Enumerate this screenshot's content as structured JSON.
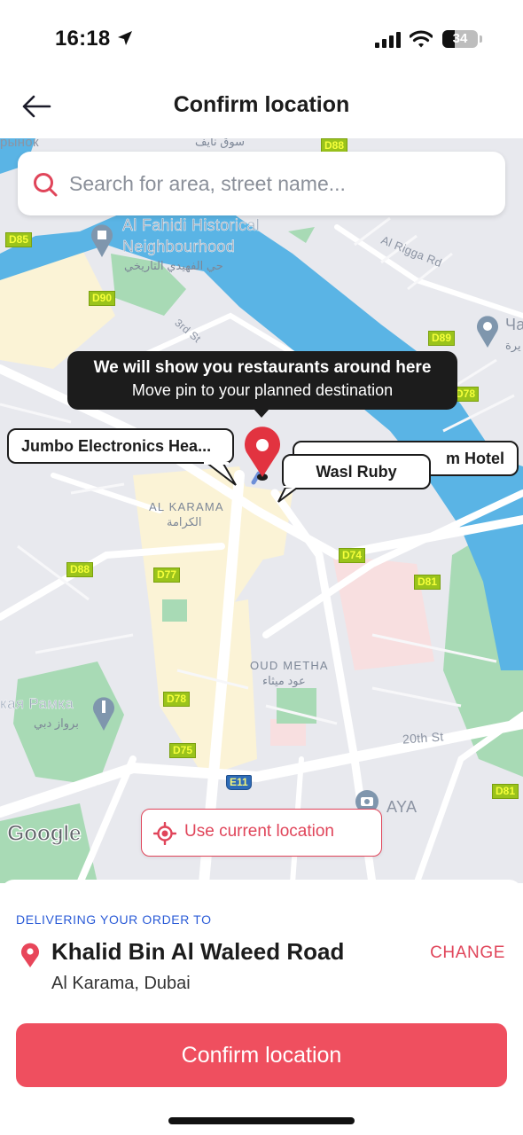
{
  "status_bar": {
    "time": "16:18",
    "battery_percent": 34,
    "battery_label": "34",
    "icons": [
      "location-arrow-icon",
      "cellular-signal-icon",
      "wifi-icon",
      "battery-icon"
    ]
  },
  "header": {
    "back_icon": "arrow-left-icon",
    "title": "Confirm location"
  },
  "search": {
    "placeholder": "Search for area, street name...",
    "value": "",
    "icon": "search-icon"
  },
  "map": {
    "tooltip": {
      "line1": "We will show you restaurants around here",
      "line2": "Move pin to your planned destination"
    },
    "nearby_places": [
      {
        "label": "Jumbo Electronics Hea..."
      },
      {
        "label": "m Hotel"
      },
      {
        "label": "Wasl Ruby"
      }
    ],
    "labels": {
      "top_left_ru": "рынок",
      "top_ar": "سوق نايف",
      "fahidi_en_1": "Al Fahidi Historical",
      "fahidi_en_2": "Neighbourhood",
      "fahidi_ar": "حي الفهيدي التاريخي",
      "al_rigga": "Al Rigga Rd",
      "third_st": "3rd St",
      "karama_en": "AL KARAMA",
      "karama_ar": "الكرامة",
      "oud_metha_en": "OUD METHA",
      "oud_metha_ar": "عود ميثاء",
      "frame_ru": "кая Рамка",
      "frame_ar": "برواز دبي",
      "twentieth_st": "20th St",
      "aya": "AYA",
      "right_edge_1": "Ча",
      "right_edge_2": "يرة"
    },
    "road_shields": {
      "d88_top": "D88",
      "d85": "D85",
      "d90": "D90",
      "d89": "D89",
      "d78_r": "D78",
      "d74": "D74",
      "d81_a": "D81",
      "d88_b": "D88",
      "d77": "D77",
      "d78": "D78",
      "d75": "D75",
      "e11": "E11",
      "d81_b": "D81"
    },
    "attribution": "Google",
    "use_current_location": "Use current location"
  },
  "delivery": {
    "label": "DELIVERING YOUR ORDER TO",
    "address_title": "Khalid Bin Al Waleed Road",
    "address_subtitle": "Al Karama, Dubai",
    "change_label": "CHANGE"
  },
  "confirm_button": "Confirm location",
  "colors": {
    "accent": "#ef4f5f",
    "accent_text": "#e0455a",
    "link_blue": "#2a5bd7",
    "water": "#5ab4e5",
    "park": "#a8dab5",
    "map_bg": "#e8e9ee"
  }
}
